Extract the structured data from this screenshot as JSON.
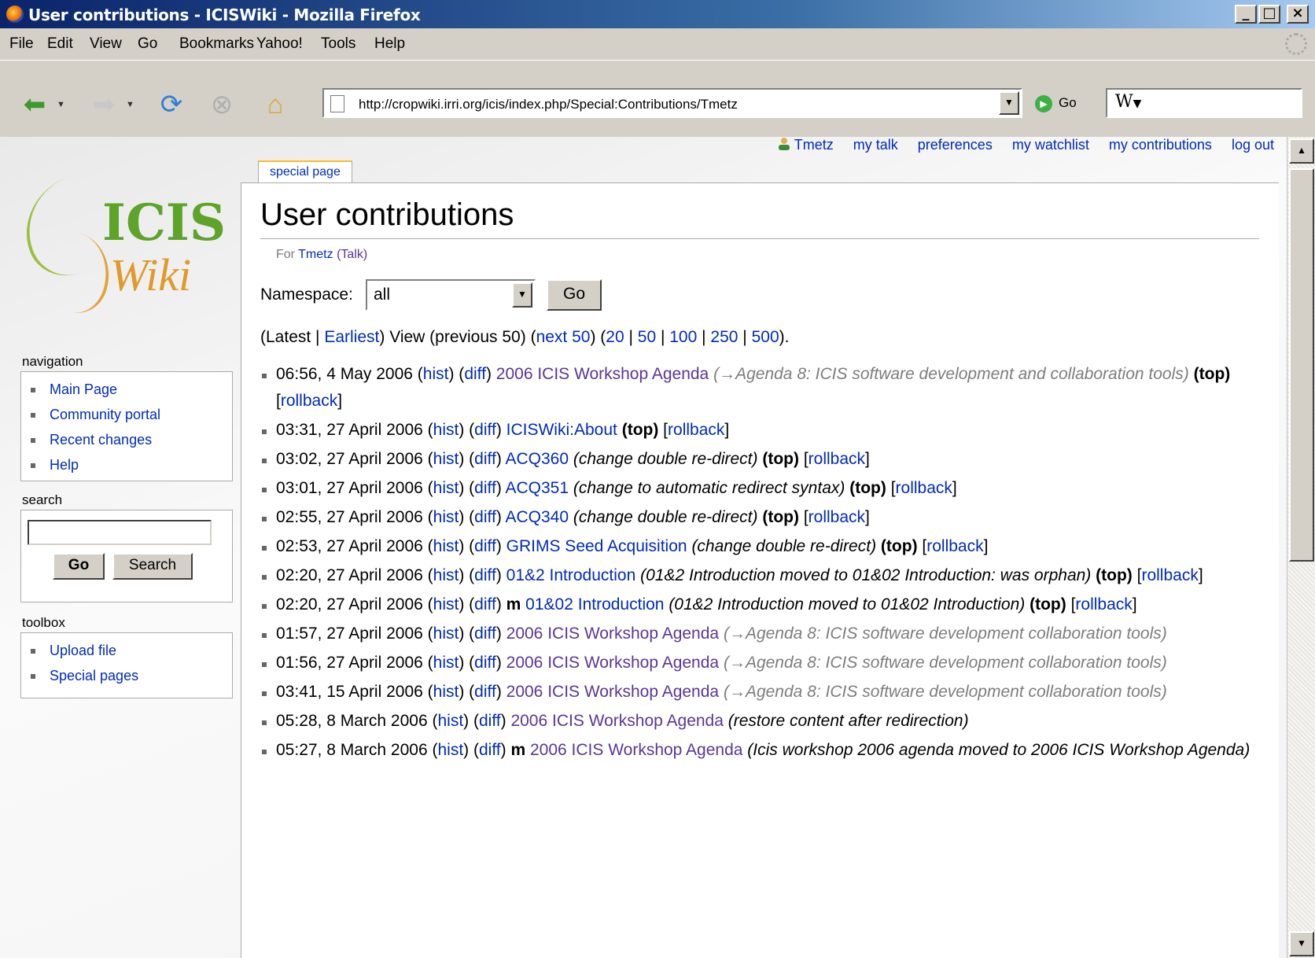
{
  "window": {
    "title": "User contributions - ICISWiki - Mozilla Firefox",
    "min_label": "_",
    "max_label": "□",
    "close_label": "×"
  },
  "menu": [
    "File",
    "Edit",
    "View",
    "Go",
    "Bookmarks",
    "Yahoo!",
    "Tools",
    "Help"
  ],
  "toolbar": {
    "url": "http://cropwiki.irri.org/icis/index.php/Special:Contributions/Tmetz",
    "go_label": "Go",
    "search_engine": "W"
  },
  "personal": {
    "user": "Tmetz",
    "links": [
      "my talk",
      "preferences",
      "my watchlist",
      "my contributions",
      "log out"
    ]
  },
  "tab": "special page",
  "heading": "User contributions",
  "subtitle": {
    "prefix": "For ",
    "user": "Tmetz",
    "talk": "(Talk)"
  },
  "namespace": {
    "label": "Namespace:",
    "value": "all",
    "go": "Go"
  },
  "pager": {
    "open": "(",
    "latest": "Latest",
    "sep": " | ",
    "earliest": "Earliest",
    "mid": ") View (previous 50) (",
    "next": "next 50",
    "mid2": ") (",
    "n20": "20",
    "n50": "50",
    "n100": "100",
    "n250": "250",
    "n500": "500",
    "end": ")."
  },
  "contributions": [
    {
      "date": "06:56, 4 May 2006",
      "page": "2006 ICIS Workshop Agenda",
      "visited": true,
      "minor": false,
      "comment": "(→Agenda 8: ICIS software development and collaboration tools)",
      "auto": true,
      "top": "(top)",
      "rollback": "rollback"
    },
    {
      "date": "03:31, 27 April 2006",
      "page": "ICISWiki:About",
      "visited": false,
      "minor": false,
      "comment": "",
      "auto": false,
      "top": "(top)",
      "rollback": "rollback"
    },
    {
      "date": "03:02, 27 April 2006",
      "page": "ACQ360",
      "visited": false,
      "minor": false,
      "comment": "(change double re-direct)",
      "auto": false,
      "top": "(top)",
      "rollback": "rollback"
    },
    {
      "date": "03:01, 27 April 2006",
      "page": "ACQ351",
      "visited": false,
      "minor": false,
      "comment": "(change to automatic redirect syntax)",
      "auto": false,
      "top": "(top)",
      "rollback": "rollback"
    },
    {
      "date": "02:55, 27 April 2006",
      "page": "ACQ340",
      "visited": false,
      "minor": false,
      "comment": "(change double re-direct)",
      "auto": false,
      "top": "(top)",
      "rollback": "rollback"
    },
    {
      "date": "02:53, 27 April 2006",
      "page": "GRIMS Seed Acquisition",
      "visited": false,
      "minor": false,
      "comment": "(change double re-direct)",
      "auto": false,
      "top": "(top)",
      "rollback": "rollback"
    },
    {
      "date": "02:20, 27 April 2006",
      "page": "01&2 Introduction",
      "visited": false,
      "minor": false,
      "comment": "(01&2 Introduction moved to 01&02 Introduction: was orphan)",
      "auto": false,
      "top": "(top)",
      "rollback": "rollback"
    },
    {
      "date": "02:20, 27 April 2006",
      "page": "01&02 Introduction",
      "visited": false,
      "minor": true,
      "comment": "(01&2 Introduction moved to 01&02 Introduction)",
      "auto": false,
      "top": "(top)",
      "rollback": "rollback"
    },
    {
      "date": "01:57, 27 April 2006",
      "page": "2006 ICIS Workshop Agenda",
      "visited": true,
      "minor": false,
      "comment": "(→Agenda 8: ICIS software development collaboration tools)",
      "auto": true,
      "top": "",
      "rollback": ""
    },
    {
      "date": "01:56, 27 April 2006",
      "page": "2006 ICIS Workshop Agenda",
      "visited": true,
      "minor": false,
      "comment": "(→Agenda 8: ICIS software development collaboration tools)",
      "auto": true,
      "top": "",
      "rollback": ""
    },
    {
      "date": "03:41, 15 April 2006",
      "page": "2006 ICIS Workshop Agenda",
      "visited": true,
      "minor": false,
      "comment": "(→Agenda 8: ICIS software development collaboration tools)",
      "auto": true,
      "top": "",
      "rollback": ""
    },
    {
      "date": "05:28, 8 March 2006",
      "page": "2006 ICIS Workshop Agenda",
      "visited": true,
      "minor": false,
      "comment": "(restore content after redirection)",
      "auto": false,
      "top": "",
      "rollback": ""
    },
    {
      "date": "05:27, 8 March 2006",
      "page": "2006 ICIS Workshop Agenda",
      "visited": true,
      "minor": true,
      "comment": "(Icis workshop 2006 agenda moved to 2006 ICIS Workshop Agenda)",
      "auto": false,
      "top": "",
      "rollback": ""
    }
  ],
  "row_labels": {
    "hist": "hist",
    "diff": "diff",
    "minor": "m"
  },
  "logo": {
    "line1": "ICIS",
    "line2": "Wiki"
  },
  "sidebar": {
    "navigation": {
      "title": "navigation",
      "items": [
        "Main Page",
        "Community portal",
        "Recent changes",
        "Help"
      ]
    },
    "search": {
      "title": "search",
      "go": "Go",
      "search": "Search"
    },
    "toolbox": {
      "title": "toolbox",
      "items": [
        "Upload file",
        "Special pages"
      ]
    }
  },
  "colors": {
    "link": "#002bb8",
    "visited": "#5a3696",
    "titlebar": "#0a246a"
  }
}
